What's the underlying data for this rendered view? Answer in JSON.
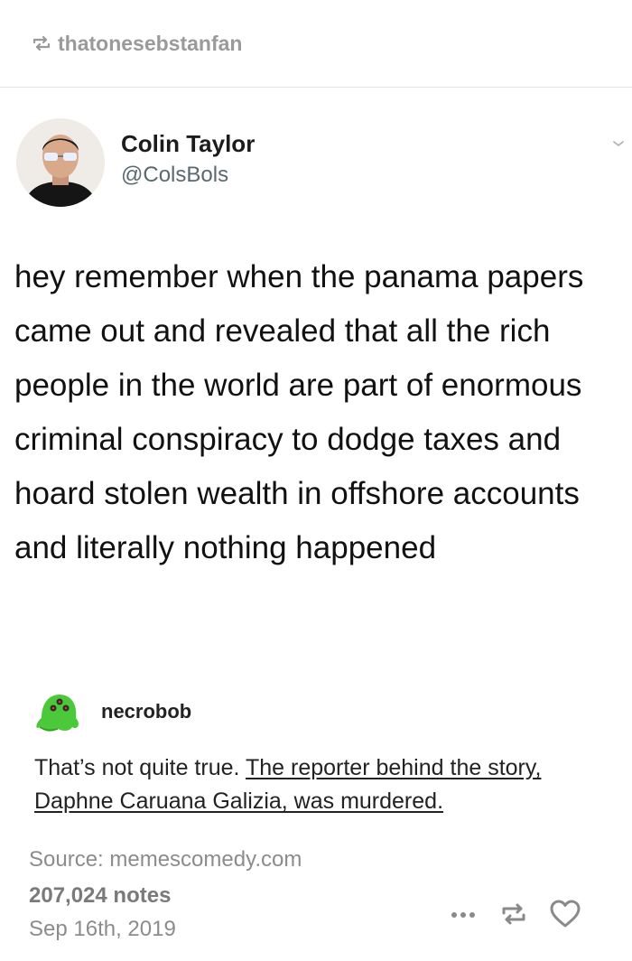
{
  "post": {
    "reblogger": "thatonesebstanfan",
    "icons": {
      "reblog": "reblog-icon"
    }
  },
  "tweet": {
    "name": "Colin Taylor",
    "handle": "@ColsBols",
    "text": "hey remember when the panama papers came out and revealed that all the rich people in the world are part of enormous criminal conspiracy to dodge taxes and hoard stolen wealth in offshore accounts and literally nothing happened"
  },
  "reply": {
    "username": "necrobob",
    "text_plain": "That’s not quite true.",
    "text_link": "The reporter behind the story, Daphne Caruana Galizia, was murdered."
  },
  "footer": {
    "source": "Source: memescomedy.com",
    "notes": "207,024 notes",
    "date": "Sep 16th, 2019",
    "icons": [
      "more-icon",
      "reblog-icon",
      "heart-icon"
    ]
  },
  "colors": {
    "muted": "#8c8c8c",
    "divider": "#e4e4e4",
    "avatar_green": "#4cc93a"
  }
}
